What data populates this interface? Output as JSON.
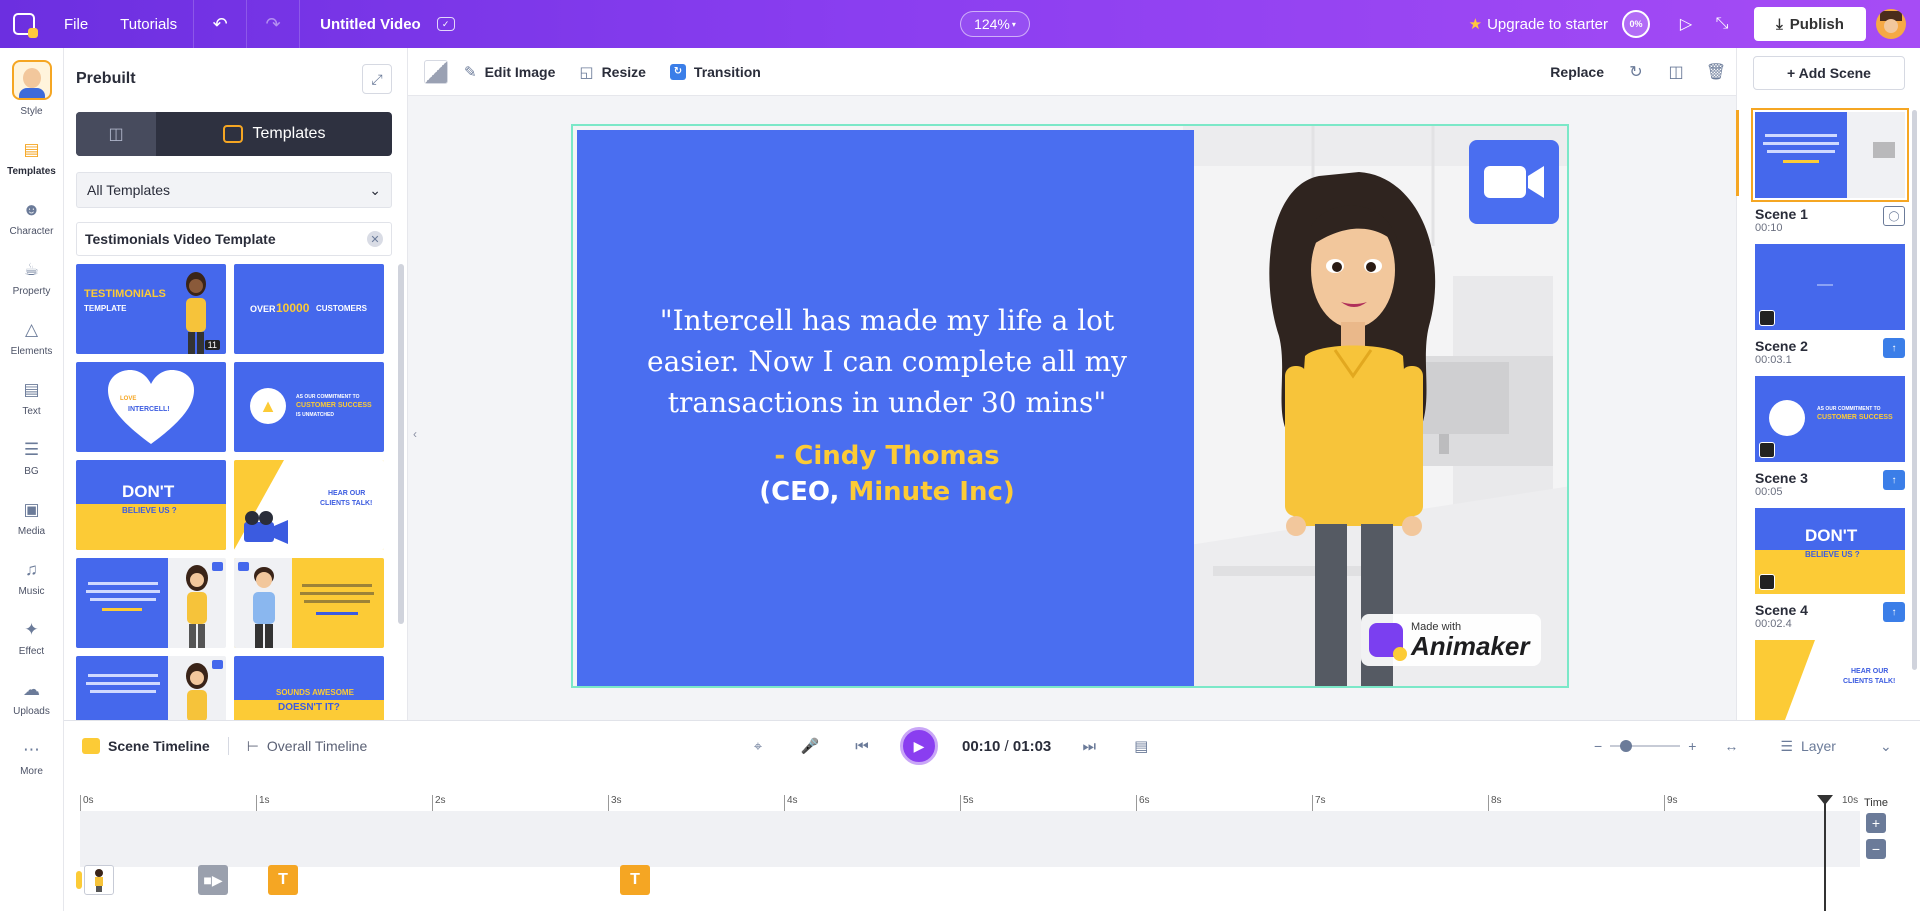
{
  "app": {
    "menu_file": "File",
    "menu_tutorials": "Tutorials",
    "title": "Untitled Video",
    "zoom": "124%",
    "upgrade": "Upgrade to starter",
    "progress_badge": "0%",
    "publish": "Publish"
  },
  "rail": {
    "items": [
      {
        "label": "Style",
        "icon": "avatar-icon"
      },
      {
        "label": "Templates",
        "icon": "templates-icon"
      },
      {
        "label": "Character",
        "icon": "character-icon"
      },
      {
        "label": "Property",
        "icon": "property-icon"
      },
      {
        "label": "Elements",
        "icon": "elements-icon"
      },
      {
        "label": "Text",
        "icon": "text-icon"
      },
      {
        "label": "BG",
        "icon": "bg-icon"
      },
      {
        "label": "Media",
        "icon": "media-icon"
      },
      {
        "label": "Music",
        "icon": "music-icon"
      },
      {
        "label": "Effect",
        "icon": "effect-icon"
      },
      {
        "label": "Uploads",
        "icon": "uploads-icon"
      },
      {
        "label": "More",
        "icon": "more-icon"
      }
    ]
  },
  "library": {
    "title": "Prebuilt",
    "tab_templates": "Templates",
    "category_select": "All Templates",
    "search_value": "Testimonials Video Template",
    "thumbs": {
      "t1_line1": "TESTIMONIALS",
      "t1_line2": "TEMPLATE",
      "t1_count": "11",
      "t2_line1": "OVER",
      "t2_line2": "10000",
      "t2_line3": "CUSTOMERS",
      "t3_line1": "LOVE",
      "t3_line2": "INTERCELL!",
      "t4_line1": "AS OUR COMMITMENT TO",
      "t4_line2": "CUSTOMER SUCCESS",
      "t4_line3": "IS UNMATCHED",
      "t5_line1": "DON'T",
      "t5_line2": "BELIEVE US ?",
      "t6_line1": "HEAR OUR",
      "t6_line2": "CLIENTS TALK!",
      "t10_line1": "SOUNDS AWESOME",
      "t10_line2": "DOESN'T IT?"
    }
  },
  "toolbar": {
    "edit_image": "Edit Image",
    "resize": "Resize",
    "transition": "Transition",
    "replace": "Replace"
  },
  "canvas": {
    "quote": "\"Intercell has made my life a lot easier. Now I can complete all my transactions in under 30 mins\"",
    "author_name": "- Cindy Thomas",
    "author_role_open": "(CEO,",
    "author_company": "Minute Inc)",
    "watermark_small": "Made with",
    "watermark_big": "Animaker"
  },
  "scenes": {
    "add_label": "+ Add Scene",
    "items": [
      {
        "name": "Scene 1",
        "time": "00:10"
      },
      {
        "name": "Scene 2",
        "time": "00:03.1"
      },
      {
        "name": "Scene 3",
        "time": "00:05"
      },
      {
        "name": "Scene 4",
        "time": "00:02.4"
      }
    ],
    "thumb3_line1": "AS OUR COMMITMENT TO",
    "thumb3_line2": "CUSTOMER SUCCESS",
    "thumb4_line1": "DON'T",
    "thumb4_line2": "BELIEVE US ?",
    "thumb5_line1": "HEAR OUR",
    "thumb5_line2": "CLIENTS TALK!"
  },
  "timeline": {
    "scene_timeline": "Scene Timeline",
    "overall_timeline": "Overall Timeline",
    "current_time": "00:10",
    "separator": "/",
    "total_time": "01:03",
    "layer": "Layer",
    "time_label": "Time",
    "ticks": [
      "0s",
      "1s",
      "2s",
      "3s",
      "4s",
      "5s",
      "6s",
      "7s",
      "8s",
      "9s",
      "10s"
    ],
    "text_item": "T"
  },
  "colors": {
    "accent_purple": "#8a3ef0",
    "quote_blue": "#4a6ef0",
    "highlight_yellow": "#fccb36",
    "selection_teal": "#7be8c8"
  }
}
